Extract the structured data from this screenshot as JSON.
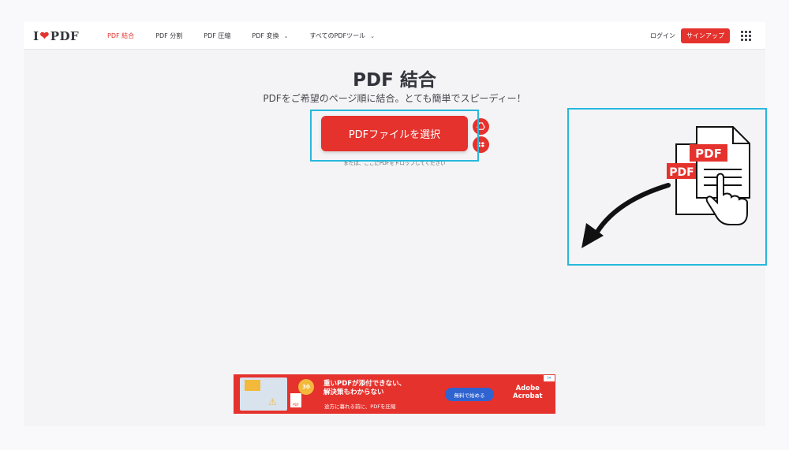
{
  "header": {
    "logo_left": "I",
    "logo_right": "PDF",
    "nav": [
      {
        "label": "PDF 結合",
        "dropdown": false,
        "active": true
      },
      {
        "label": "PDF 分割",
        "dropdown": false,
        "active": false
      },
      {
        "label": "PDF 圧縮",
        "dropdown": false,
        "active": false
      },
      {
        "label": "PDF 変換",
        "dropdown": true,
        "active": false
      },
      {
        "label": "すべてのPDFツール",
        "dropdown": true,
        "active": false
      }
    ],
    "login": "ログイン",
    "signup": "サインアップ"
  },
  "main": {
    "title": "PDF 結合",
    "subtitle": "PDFをご希望のページ順に結合。とても簡単でスピーディー！",
    "select_button": "PDFファイルを選択",
    "drop_hint": "または、ここにPDFをドロップしてください"
  },
  "illustration": {
    "label_front": "PDF",
    "label_back": "PDF"
  },
  "ad": {
    "badge_top": "30",
    "badge_bottom": "日間",
    "doc_label": "PDF",
    "headline": "重いPDFが添付できない、\n解決策もわからない",
    "tagline": "途方に暮れる前に、PDFを圧縮",
    "cta": "無料で始める",
    "brand": "Adobe\nAcrobat"
  },
  "colors": {
    "brand_red": "#e5322d",
    "highlight_cyan": "#27b8dc",
    "text_dark": "#33333b"
  }
}
